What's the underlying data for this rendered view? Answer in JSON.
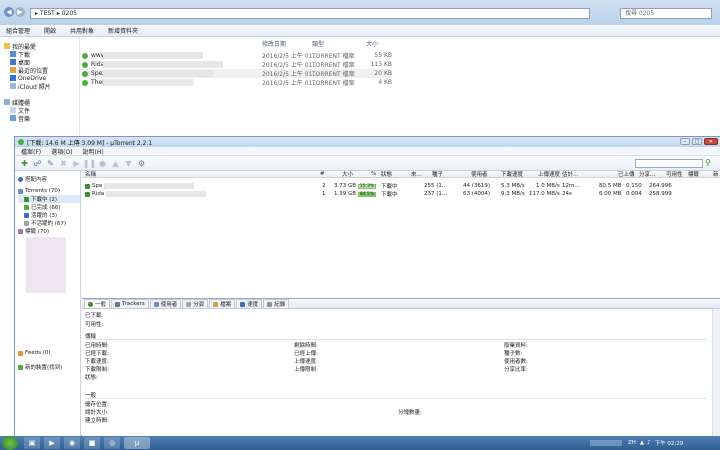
{
  "explorer": {
    "breadcrumb": [
      "TEST",
      "0205"
    ],
    "search_placeholder": "搜尋 0205",
    "toolbar": [
      "組合管理",
      "開啟",
      "共用對象",
      "新增資料夾"
    ],
    "nav": {
      "favorites_title": "我的最愛",
      "favorites": [
        "下載",
        "桌面",
        "最近的位置",
        "OneDrive",
        "iCloud 照片"
      ],
      "libraries_title": "媒體櫃",
      "libraries": [
        "文件",
        "音樂"
      ]
    },
    "columns": [
      "修改日期",
      "類型",
      "大小"
    ],
    "files": [
      {
        "name": "www",
        "date": "2016/2/5 上午 01...",
        "type": "TORRENT 檔案",
        "size": "55 KB"
      },
      {
        "name": "Rida",
        "date": "2016/2/5 上午 01...",
        "type": "TORRENT 檔案",
        "size": "113 KB"
      },
      {
        "name": "Spez",
        "date": "2016/2/5 上午 01...",
        "type": "TORRENT 檔案",
        "size": "20 KB"
      },
      {
        "name": "TheP",
        "date": "2016/2/5 上午 01...",
        "type": "TORRENT 檔案",
        "size": "4 KB"
      }
    ]
  },
  "utorrent": {
    "title": "[下載: 14.6 M 上傳 3.09 M] - µTorrent 2.2.1",
    "menu": [
      "檔案(F)",
      "選項(O)",
      "說明(H)"
    ],
    "side": {
      "guide": "搭配內容",
      "torrents": "Torrents (70)",
      "downloading": "下載中 (2)",
      "completed": "已完成 (66)",
      "active": "活躍的 (3)",
      "inactive": "不活躍的 (67)",
      "labels": "標籤 (70)",
      "feeds": "Feeds (0)",
      "devices": "新的裝置(找到)"
    },
    "columns": [
      "名稱",
      "#",
      "大小",
      "%",
      "狀態",
      "來...",
      "種子",
      "使用者",
      "下載速度",
      "上傳速度",
      "估計...",
      "已上傳",
      "分享...",
      "可用性",
      "標籤",
      "新"
    ],
    "torrents": [
      {
        "name": "Spe",
        "num": "2",
        "size": "3.73 GB",
        "pct": "15.3%",
        "status": "下載中",
        "seeds": "255 (1...",
        "peers": "44 (3619)",
        "down": "5.3 MB/s",
        "up": "1.0 MB/s",
        "eta": "12m...",
        "uploaded": "80.5 MB",
        "ratio": "0.150",
        "avail": "264.996",
        "label": ""
      },
      {
        "name": "Rida",
        "num": "1",
        "size": "1.39 GB",
        "pct": "84.5%",
        "status": "下載中",
        "seeds": "237 (1...",
        "peers": "63 (4004)",
        "down": "9.3 MB/s",
        "up": "117.0 MB/s",
        "eta": "24s",
        "uploaded": "6.00 MB",
        "ratio": "0.004",
        "avail": "258.999",
        "label": ""
      }
    ],
    "tabs": [
      "一般",
      "Trackers",
      "使用者",
      "分頁",
      "檔案",
      "速度",
      "紀錄"
    ],
    "detail": {
      "downloaded": "已下載:",
      "availability": "可用性:",
      "transfer": "傳輸",
      "time_elapsed": "已用時間:",
      "remaining": "剩餘時間:",
      "wasted": "廢棄資料:",
      "downloaded2": "已經下載:",
      "uploaded": "已經上傳:",
      "seeds": "種子數:",
      "down_speed": "下載速度:",
      "up_speed": "上傳速度:",
      "peers": "使用者數:",
      "down_limit": "下載限制:",
      "up_limit": "上傳限制:",
      "share_ratio": "分享比率:",
      "status": "狀態:",
      "general": "一般",
      "save_as": "儲存位置:",
      "total_size": "總計大小:",
      "pieces": "分塊數量:",
      "created": "建立時間:"
    }
  },
  "taskbar": {
    "tray_text": "ZH",
    "time": "下午 02:29"
  }
}
